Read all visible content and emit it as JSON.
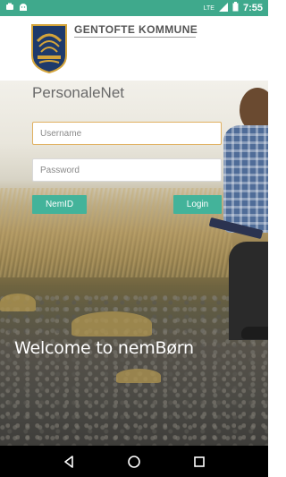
{
  "status_bar": {
    "time": "7:55",
    "network": "LTE",
    "left_icons": [
      "notification-icon",
      "android-icon"
    ],
    "right_icons": [
      "signal-icon",
      "battery-icon"
    ]
  },
  "header": {
    "brand": "GENTOFTE KOMMUNE",
    "logo": "gentofte-crest-icon"
  },
  "app_title": "PersonaleNet",
  "login_form": {
    "username_placeholder": "Username",
    "password_placeholder": "Password",
    "nemid_label": "NemID",
    "login_label": "Login"
  },
  "welcome_text": "Welcome to nemBørn",
  "nav_bar": {
    "back": "back-icon",
    "home": "home-icon",
    "recents": "recents-icon"
  },
  "colors": {
    "status_bar": "#3fa98c",
    "button": "#43b39a",
    "focused_border": "#e0b060"
  }
}
